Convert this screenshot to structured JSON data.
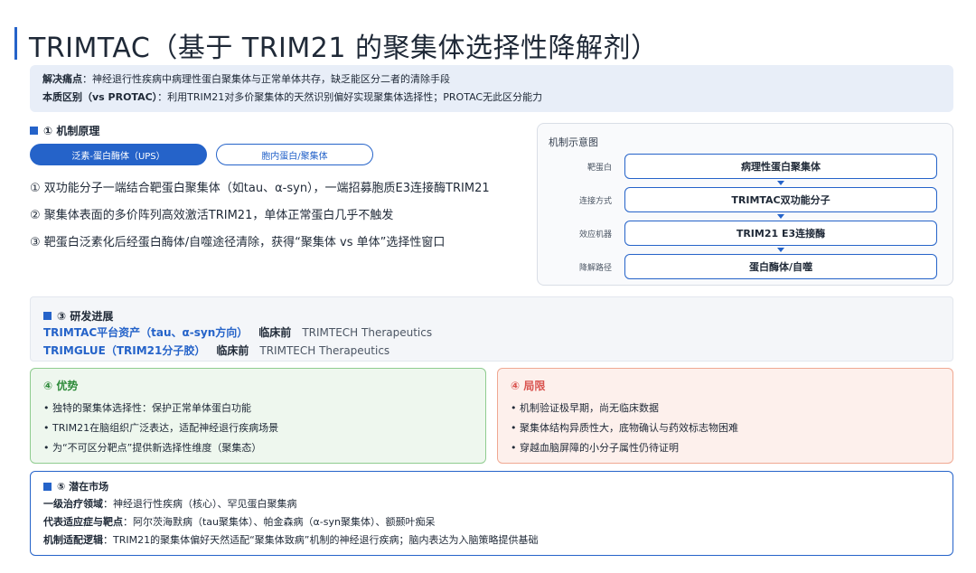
{
  "title": "TRIMTAC（基于 TRIM21 的聚集体选择性降解剂）",
  "summary": {
    "pain_label": "解决痛点",
    "pain_text": "：神经退行性疾病中病理性蛋白聚集体与正常单体共存，缺乏能区分二者的清除手段",
    "diff_label": "本质区别（vs PROTAC）",
    "diff_text": "：利用TRIM21对多价聚集体的天然识别偏好实现聚集体选择性；PROTAC无此区分能力"
  },
  "mechanism": {
    "heading": "① 机制原理",
    "tabs": [
      "泛素-蛋白酶体（UPS）",
      "胞内蛋白/聚集体"
    ],
    "steps": [
      "① 双功能分子一端结合靶蛋白聚集体（如tau、α-syn），一端招募胞质E3连接酶TRIM21",
      "② 聚集体表面的多价阵列高效激活TRIM21，单体正常蛋白几乎不触发",
      "③ 靶蛋白泛素化后经蛋白酶体/自噬途径清除，获得“聚集体 vs 单体”选择性窗口"
    ]
  },
  "diagram": {
    "title": "机制示意图",
    "rows": [
      {
        "label": "靶蛋白",
        "value": "病理性蛋白聚集体"
      },
      {
        "label": "连接方式",
        "value": "TRIMTAC双功能分子"
      },
      {
        "label": "效应机器",
        "value": "TRIM21 E3连接酶"
      },
      {
        "label": "降解路径",
        "value": "蛋白酶体/自噬"
      }
    ]
  },
  "progress": {
    "heading": "③ 研发进展",
    "rows": [
      {
        "name": "TRIMTAC平台资产（tau、α-syn方向）",
        "stage": "临床前",
        "company": "TRIMTECH Therapeutics"
      },
      {
        "name": "TRIMGLUE（TRIM21分子胶）",
        "stage": "临床前",
        "company": "TRIMTECH Therapeutics"
      }
    ]
  },
  "advantages": {
    "heading": "④ 优势",
    "items": [
      "• 独特的聚集体选择性：保护正常单体蛋白功能",
      "• TRIM21在脑组织广泛表达，适配神经退行疾病场景",
      "• 为“不可区分靶点”提供新选择性维度（聚集态）"
    ]
  },
  "limitations": {
    "heading": "④ 局限",
    "items": [
      "• 机制验证极早期，尚无临床数据",
      "• 聚集体结构异质性大，底物确认与药效标志物困难",
      "• 穿越血脑屏障的小分子属性仍待证明"
    ]
  },
  "market": {
    "heading": "⑤ 潜在市场",
    "rows": [
      {
        "label": "一级治疗领域",
        "text": "：神经退行性疾病（核心）、罕见蛋白聚集病"
      },
      {
        "label": "代表适应症与靶点",
        "text": "：阿尔茨海默病（tau聚集体）、帕金森病（α-syn聚集体）、额颞叶痴呆"
      },
      {
        "label": "机制适配逻辑",
        "text": "：TRIM21的聚集体偏好天然适配“聚集体致病”机制的神经退行疾病；脑内表达为入脑策略提供基础"
      }
    ]
  },
  "colors": {
    "accent": "#2563c9",
    "advantage": "#2e8b3a",
    "limitation": "#d9534f"
  }
}
